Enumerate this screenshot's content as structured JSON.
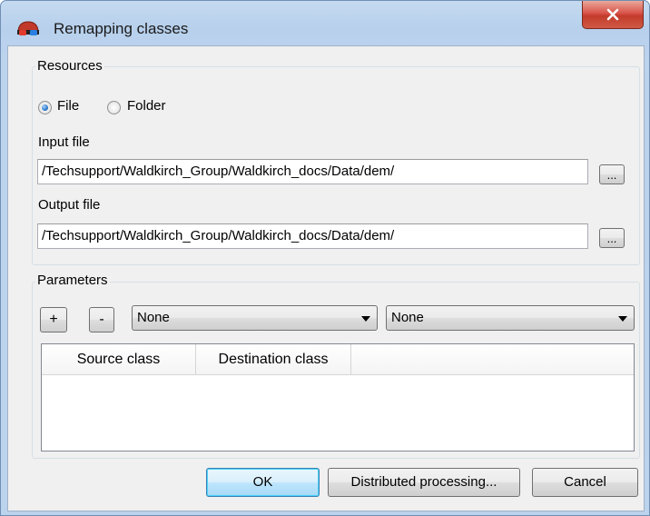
{
  "window": {
    "title": "Remapping classes",
    "icon": "3d-glasses-icon",
    "close_icon": "close-icon"
  },
  "resources": {
    "group_title": "Resources",
    "source_options": [
      {
        "label": "File",
        "checked": true
      },
      {
        "label": "Folder",
        "checked": false
      }
    ],
    "input_label": "Input file",
    "input_value": "/Techsupport/Waldkirch_Group/Waldkirch_docs/Data/dem/",
    "output_label": "Output file",
    "output_value": "/Techsupport/Waldkirch_Group/Waldkirch_docs/Data/dem/",
    "browse_label": "..."
  },
  "parameters": {
    "group_title": "Parameters",
    "add_label": "+",
    "remove_label": "-",
    "source_combo_value": "None",
    "destination_combo_value": "None",
    "table_columns": [
      "Source class",
      "Destination class"
    ],
    "table_rows": []
  },
  "footer": {
    "ok_label": "OK",
    "distributed_label": "Distributed processing...",
    "cancel_label": "Cancel"
  }
}
